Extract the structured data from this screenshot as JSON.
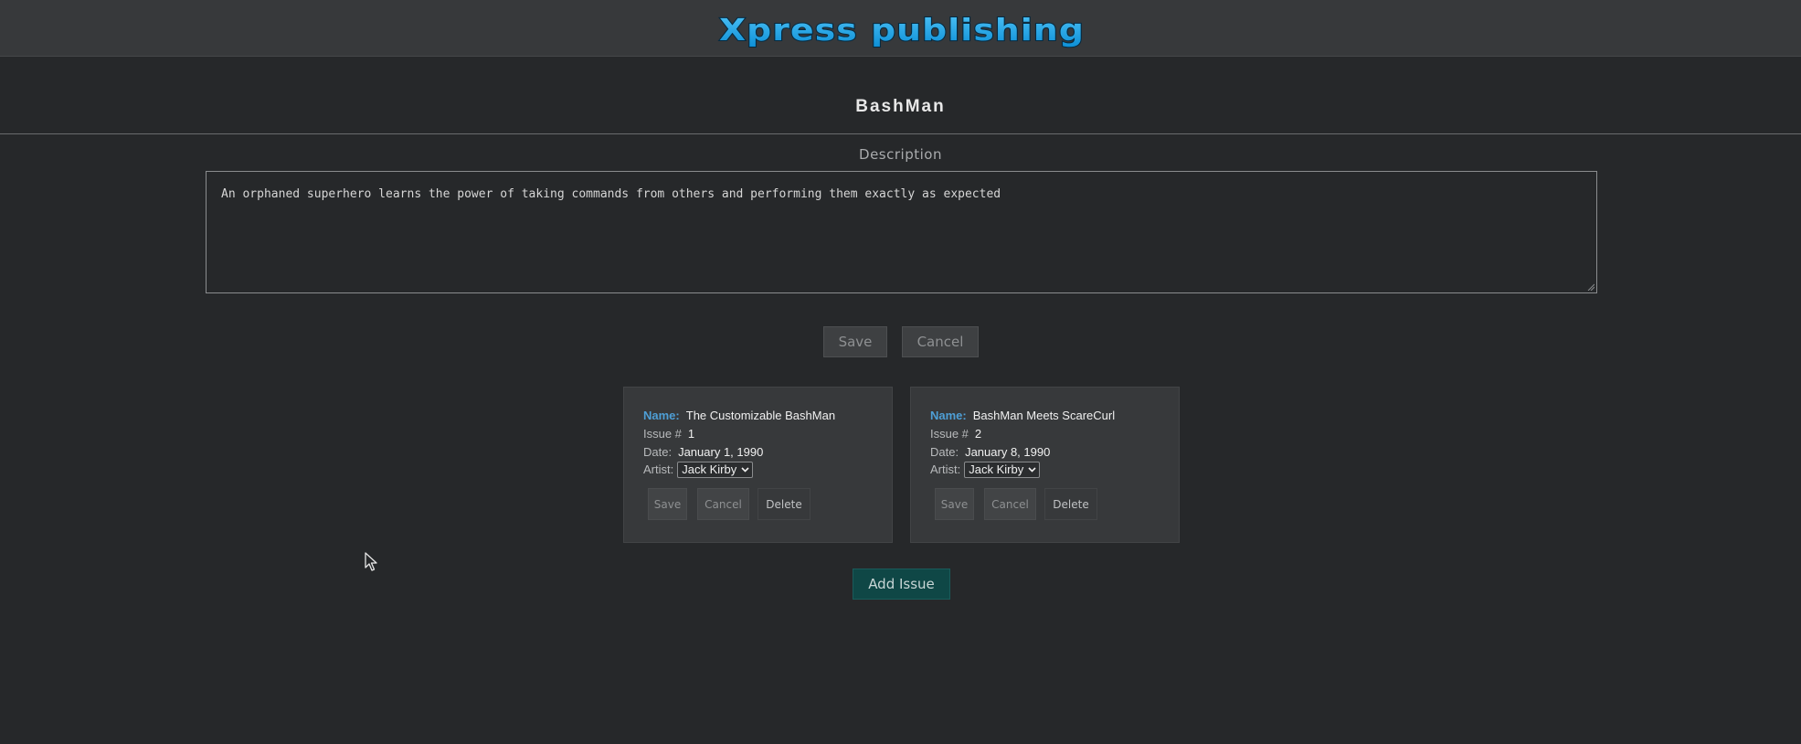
{
  "header": {
    "logo_text": "Xpress publishing",
    "logo_color": "#1aa3e8"
  },
  "series": {
    "title": "BashMan",
    "description_label": "Description",
    "description": "An orphaned superhero learns the power of taking commands from others and performing them exactly as expected",
    "save_label": "Save",
    "cancel_label": "Cancel"
  },
  "issue_field_labels": {
    "name": "Name:",
    "issue": "Issue #",
    "date": "Date:",
    "artist": "Artist:"
  },
  "issues": [
    {
      "name": "The Customizable BashMan",
      "issue_number": "1",
      "date": "January 1, 1990",
      "artist": "Jack Kirby",
      "save_label": "Save",
      "cancel_label": "Cancel",
      "delete_label": "Delete"
    },
    {
      "name": "BashMan Meets ScareCurl",
      "issue_number": "2",
      "date": "January 8, 1990",
      "artist": "Jack Kirby",
      "save_label": "Save",
      "cancel_label": "Cancel",
      "delete_label": "Delete"
    }
  ],
  "add_issue_label": "Add Issue",
  "colors": {
    "background": "#26282a",
    "header": "#37393b",
    "name_label": "#4e9fd6",
    "add_button": "#0f4746"
  }
}
